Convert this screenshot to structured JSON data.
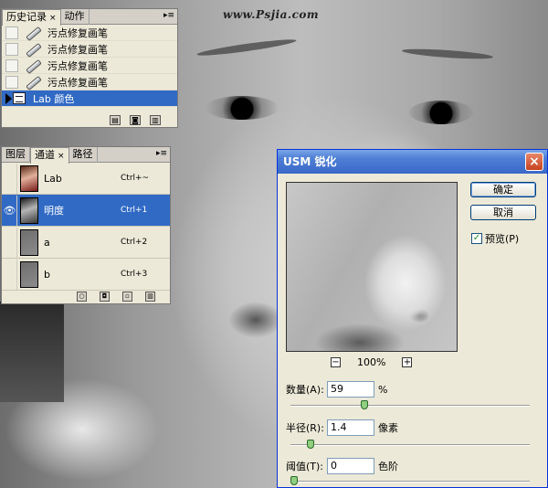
{
  "watermark": "www.Psjia.com",
  "history_panel": {
    "tabs": [
      {
        "label": "历史记录",
        "close": "×"
      },
      {
        "label": "动作"
      }
    ],
    "items": [
      {
        "label": "污点修复画笔"
      },
      {
        "label": "污点修复画笔"
      },
      {
        "label": "污点修复画笔"
      },
      {
        "label": "污点修复画笔"
      },
      {
        "label": "Lab 颜色",
        "active": true
      }
    ]
  },
  "channels_panel": {
    "tabs": [
      {
        "label": "图层"
      },
      {
        "label": "通道",
        "close": "×"
      },
      {
        "label": "路径"
      }
    ],
    "channels": [
      {
        "name": "Lab",
        "shortcut": "Ctrl+~"
      },
      {
        "name": "明度",
        "shortcut": "Ctrl+1",
        "active": true
      },
      {
        "name": "a",
        "shortcut": "Ctrl+2"
      },
      {
        "name": "b",
        "shortcut": "Ctrl+3"
      }
    ]
  },
  "usm_dialog": {
    "title": "USM 锐化",
    "close": "×",
    "ok_label": "确定",
    "cancel_label": "取消",
    "preview_label": "预览(P)",
    "preview_checked": true,
    "zoom_minus": "−",
    "zoom_plus": "+",
    "zoom_level": "100%",
    "amount": {
      "label": "数量(A):",
      "value": "59",
      "unit": "%",
      "slider_fraction": 0.295
    },
    "radius": {
      "label": "半径(R):",
      "value": "1.4",
      "unit": "像素",
      "slider_fraction": 0.07
    },
    "threshold": {
      "label": "阈值(T):",
      "value": "0",
      "unit": "色阶",
      "slider_fraction": 0.0
    }
  },
  "colors": {
    "selection": "#316ac5",
    "titlebar": "#3a68c8"
  }
}
